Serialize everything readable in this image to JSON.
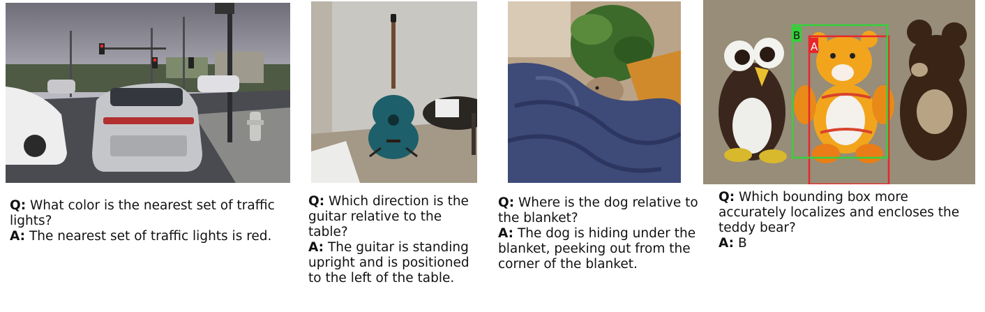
{
  "panels": [
    {
      "image_label": "street scene with traffic lights",
      "q_label": "Q:",
      "question": "What color is the nearest set of traffic lights?",
      "a_label": "A:",
      "answer": "The nearest set of traffic lights is red."
    },
    {
      "image_label": "guitar next to table",
      "q_label": "Q:",
      "question": "Which direction is the guitar relative to the table?",
      "a_label": "A:",
      "answer": "The guitar is standing upright and is positioned to the left of the table."
    },
    {
      "image_label": "dog under blanket",
      "q_label": "Q:",
      "question": "Where is the dog relative to the blanket?",
      "a_label": "A:",
      "answer": "The dog is hiding under the blanket, peeking out from the corner of the blanket."
    },
    {
      "image_label": "knitted toys with bounding boxes",
      "box_a_label": "A",
      "box_b_label": "B",
      "q_label": "Q:",
      "question": "Which bounding box more accurately localizes and encloses the teddy bear?",
      "a_label": "A:",
      "answer": "B"
    }
  ],
  "colors": {
    "box_a": "#e8262b",
    "box_b": "#35d13a"
  }
}
